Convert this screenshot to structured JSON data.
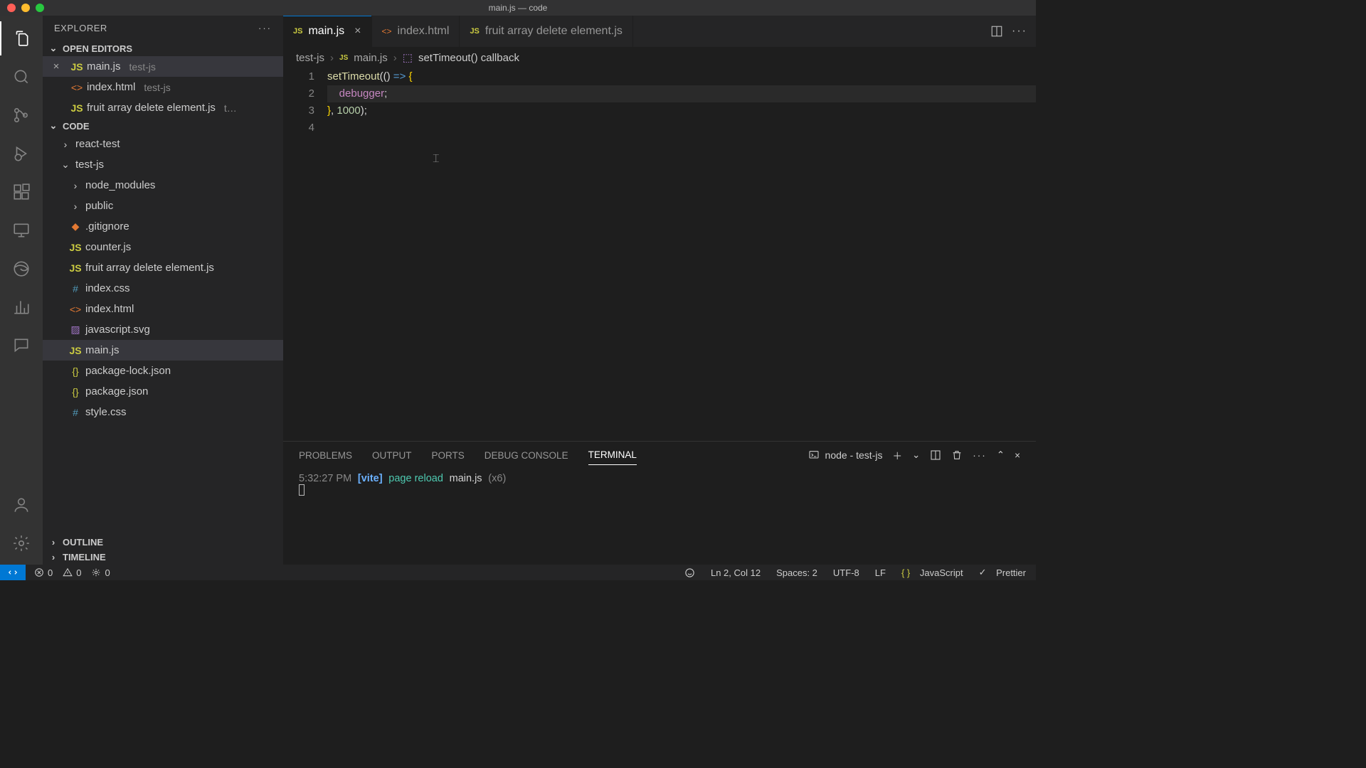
{
  "window": {
    "title": "main.js — code"
  },
  "explorer": {
    "title": "EXPLORER",
    "openEditors": {
      "label": "OPEN EDITORS",
      "items": [
        {
          "name": "main.js",
          "dir": "test-js",
          "type": "js",
          "close": "×",
          "active": true
        },
        {
          "name": "index.html",
          "dir": "test-js",
          "type": "html"
        },
        {
          "name": "fruit array delete element.js",
          "dir": "t…",
          "type": "js"
        }
      ]
    },
    "workspace": {
      "label": "CODE",
      "tree": [
        {
          "name": "react-test",
          "kind": "folder",
          "expanded": false,
          "depth": 0
        },
        {
          "name": "test-js",
          "kind": "folder",
          "expanded": true,
          "depth": 0
        },
        {
          "name": "node_modules",
          "kind": "folder",
          "expanded": false,
          "depth": 1
        },
        {
          "name": "public",
          "kind": "folder",
          "expanded": false,
          "depth": 1
        },
        {
          "name": ".gitignore",
          "kind": "git",
          "depth": 1
        },
        {
          "name": "counter.js",
          "kind": "js",
          "depth": 1
        },
        {
          "name": "fruit array delete element.js",
          "kind": "js",
          "depth": 1
        },
        {
          "name": "index.css",
          "kind": "css",
          "depth": 1
        },
        {
          "name": "index.html",
          "kind": "html",
          "depth": 1
        },
        {
          "name": "javascript.svg",
          "kind": "svg",
          "depth": 1
        },
        {
          "name": "main.js",
          "kind": "js",
          "depth": 1,
          "selected": true
        },
        {
          "name": "package-lock.json",
          "kind": "json",
          "depth": 1
        },
        {
          "name": "package.json",
          "kind": "json",
          "depth": 1
        },
        {
          "name": "style.css",
          "kind": "css",
          "depth": 1
        }
      ]
    },
    "outline": "OUTLINE",
    "timeline": "TIMELINE"
  },
  "tabs": [
    {
      "label": "main.js",
      "type": "js",
      "active": true,
      "closable": true
    },
    {
      "label": "index.html",
      "type": "html"
    },
    {
      "label": "fruit array delete element.js",
      "type": "js"
    }
  ],
  "breadcrumbs": {
    "root": "test-js",
    "file": "main.js",
    "symbol": "setTimeout() callback"
  },
  "code": {
    "lines": [
      "1",
      "2",
      "3",
      "4"
    ],
    "l1_fn": "setTimeout",
    "l1_rest1": "((",
    "l1_rest2": ")",
    "l1_arrow": " => ",
    "l1_brace": "{",
    "l2_indent": "    ",
    "l2_dbg": "debugger",
    "l2_semi": ";",
    "l3_brace": "}",
    "l3_rest": ", ",
    "l3_num": "1000",
    "l3_end": ");"
  },
  "panel": {
    "tabs": {
      "problems": "PROBLEMS",
      "output": "OUTPUT",
      "ports": "PORTS",
      "debug": "DEBUG CONSOLE",
      "terminal": "TERMINAL"
    },
    "process": "node - test-js",
    "term": {
      "time": "5:32:27 PM",
      "vite": "[vite]",
      "msg": "page reload",
      "file": "main.js",
      "count": "(x6)"
    }
  },
  "status": {
    "errors": "0",
    "warnings": "0",
    "ports": "0",
    "lncol": "Ln 2, Col 12",
    "spaces": "Spaces: 2",
    "enc": "UTF-8",
    "eol": "LF",
    "lang": "JavaScript",
    "prettier": "Prettier"
  }
}
